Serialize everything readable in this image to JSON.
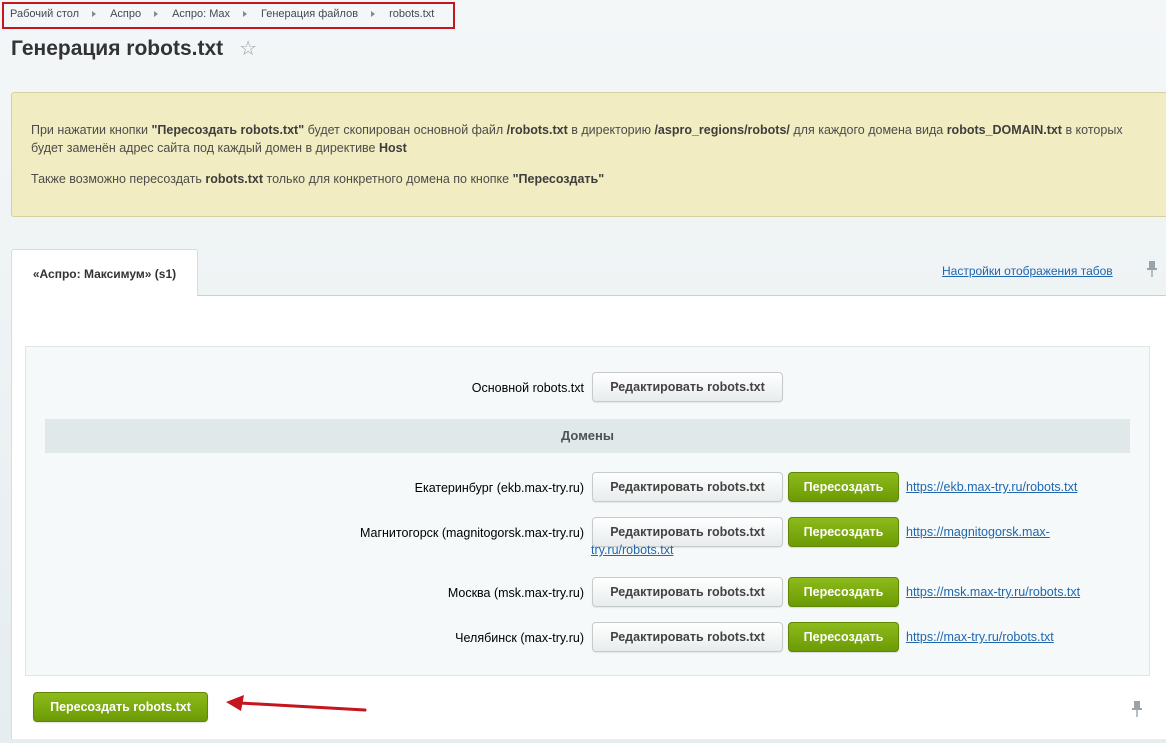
{
  "breadcrumb": {
    "items": [
      "Рабочий стол",
      "Аспро",
      "Аспро: Max",
      "Генерация файлов",
      "robots.txt"
    ]
  },
  "page": {
    "title": "Генерация robots.txt"
  },
  "notice": {
    "p1": [
      {
        "t": "При нажатии кнопки ",
        "b": false
      },
      {
        "t": "\"Пересоздать robots.txt\"",
        "b": true
      },
      {
        "t": " будет скопирован основной файл ",
        "b": false
      },
      {
        "t": "/robots.txt",
        "b": true
      },
      {
        "t": " в директорию ",
        "b": false
      },
      {
        "t": "/aspro_regions/robots/",
        "b": true
      },
      {
        "t": " для каждого домена вида ",
        "b": false
      },
      {
        "t": "robots_DOMAIN.txt",
        "b": true
      },
      {
        "t": " в которых будет заменён адрес сайта под каждый домен в директиве ",
        "b": false
      },
      {
        "t": "Host",
        "b": true
      }
    ],
    "p2": [
      {
        "t": "Также возможно пересоздать ",
        "b": false
      },
      {
        "t": "robots.txt",
        "b": true
      },
      {
        "t": " только для конкретного домена по кнопке ",
        "b": false
      },
      {
        "t": "\"Пересоздать\"",
        "b": true
      }
    ]
  },
  "tabs": {
    "active": "«Аспро: Максимум» (s1)",
    "settings_link": "Настройки отображения табов"
  },
  "main_row": {
    "label": "Основной robots.txt",
    "edit_label": "Редактировать robots.txt"
  },
  "section_title": "Домены",
  "domains": [
    {
      "label": "Екатеринбург (ekb.max-try.ru)",
      "edit_label": "Редактировать robots.txt",
      "recreate_label": "Пересоздать",
      "url": "https://ekb.max-try.ru/robots.txt"
    },
    {
      "label": "Магнитогорск (magnitogorsk.max-try.ru)",
      "edit_label": "Редактировать robots.txt",
      "recreate_label": "Пересоздать",
      "url": "https://magnitogorsk.max-try.ru/robots.txt"
    },
    {
      "label": "Москва (msk.max-try.ru)",
      "edit_label": "Редактировать robots.txt",
      "recreate_label": "Пересоздать",
      "url": "https://msk.max-try.ru/robots.txt"
    },
    {
      "label": "Челябинск (max-try.ru)",
      "edit_label": "Редактировать robots.txt",
      "recreate_label": "Пересоздать",
      "url": "https://max-try.ru/robots.txt"
    }
  ],
  "footer": {
    "recreate_all_label": "Пересоздать robots.txt"
  },
  "colors": {
    "green_button": "#7aaa0d",
    "link": "#2067b0",
    "notice_bg": "#f1ecc1",
    "annotation_red": "#c4161c"
  },
  "icons": {
    "favorite": "star-outline-icon",
    "pin": "pin-icon",
    "separator": "triangle-right-icon"
  }
}
